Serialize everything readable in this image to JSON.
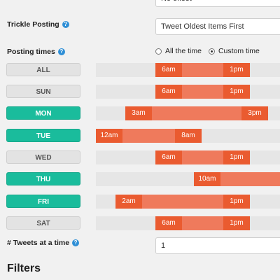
{
  "top_field": {
    "value": "No offset"
  },
  "trickle": {
    "label": "Trickle Posting",
    "help": "?",
    "value": "Tweet Oldest Items First"
  },
  "posting_times": {
    "label": "Posting times",
    "help": "?",
    "options": [
      "All the time",
      "Custom time"
    ],
    "selected": "Custom time"
  },
  "days": [
    {
      "name": "ALL",
      "active": false,
      "start_label": "6am",
      "end_label": "1pm"
    },
    {
      "name": "SUN",
      "active": false,
      "start_label": "6am",
      "end_label": "1pm"
    },
    {
      "name": "MON",
      "active": true,
      "start_label": "3am",
      "end_label": "3pm"
    },
    {
      "name": "TUE",
      "active": true,
      "start_label": "12am",
      "end_label": "8am"
    },
    {
      "name": "WED",
      "active": false,
      "start_label": "6am",
      "end_label": "1pm"
    },
    {
      "name": "THU",
      "active": true,
      "start_label": "10am",
      "end_label": ""
    },
    {
      "name": "FRI",
      "active": true,
      "start_label": "2am",
      "end_label": "1pm"
    },
    {
      "name": "SAT",
      "active": false,
      "start_label": "6am",
      "end_label": "1pm"
    }
  ],
  "tweets_at_a_time": {
    "label": "# Tweets at a time",
    "help": "?",
    "value": "1"
  },
  "filters": {
    "heading": "Filters"
  },
  "colors": {
    "active_day": "#1abc9c",
    "range_fill": "#ef7a5c",
    "handle": "#ea5b30",
    "track": "#e6e6e6"
  }
}
